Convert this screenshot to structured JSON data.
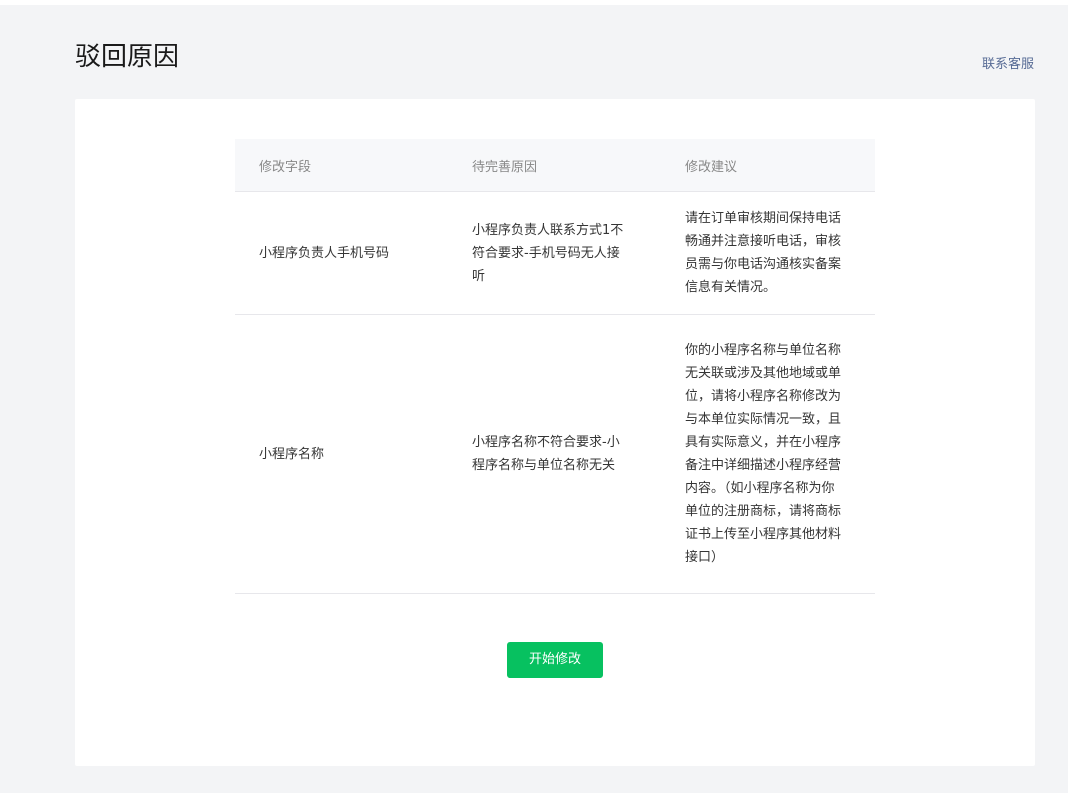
{
  "page": {
    "title": "驳回原因",
    "contact_link": "联系客服"
  },
  "table": {
    "headers": [
      "修改字段",
      "待完善原因",
      "修改建议"
    ],
    "rows": [
      {
        "field": "小程序负责人手机号码",
        "reason": "小程序负责人联系方式1不符合要求-手机号码无人接听",
        "suggestion": "请在订单审核期间保持电话畅通并注意接听电话，审核员需与你电话沟通核实备案信息有关情况。"
      },
      {
        "field": "小程序名称",
        "reason": "小程序名称不符合要求-小程序名称与单位名称无关",
        "suggestion": "你的小程序名称与单位名称无关联或涉及其他地域或单位，请将小程序名称修改为与本单位实际情况一致，且具有实际意义，并在小程序备注中详细描述小程序经营内容。（如小程序名称为你单位的注册商标，请将商标证书上传至小程序其他材料接口）"
      }
    ]
  },
  "actions": {
    "start_edit_label": "开始修改"
  },
  "colors": {
    "primary_button": "#07c160",
    "link": "#576b95",
    "page_background": "#f3f4f6",
    "table_header_background": "#f7f8fa"
  }
}
